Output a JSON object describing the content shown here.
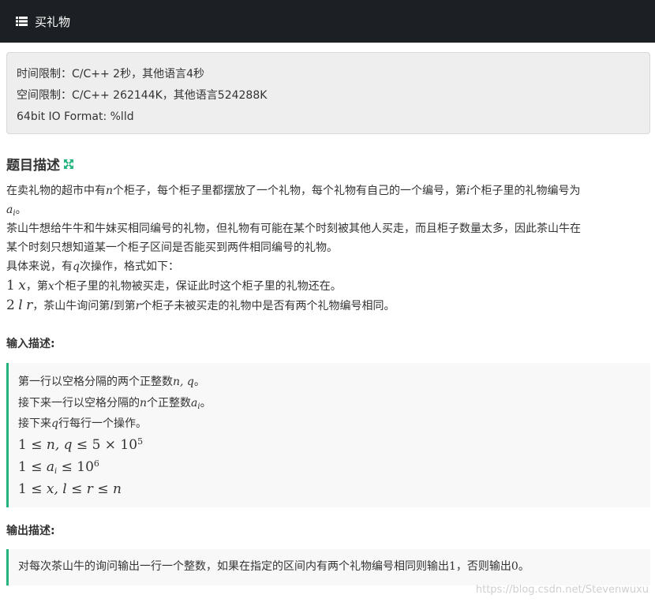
{
  "header": {
    "title": "买礼物",
    "icon": "list-icon"
  },
  "limits": {
    "time": "时间限制：C/C++ 2秒，其他语言4秒",
    "space": "空间限制：C/C++ 262144K，其他语言524288K",
    "format": "64bit IO Format: %lld"
  },
  "problem": {
    "title": "题目描述",
    "l1a": "在卖礼物的超市中有",
    "l1v1": "n",
    "l1b": "个柜子，每个柜子里都摆放了一个礼物，每个礼物有自己的一个编号，第",
    "l1v2": "i",
    "l1c": "个柜子里的礼物编号为",
    "l2v": "a",
    "l2s": "i",
    "l2p": "。",
    "l3": "茶山牛想给牛牛和牛妹买相同编号的礼物，但礼物有可能在某个时刻被其他人买走，而且柜子数量太多，因此茶山牛在",
    "l4": "某个时刻只想知道某一个柜子区间是否能买到两件相同编号的礼物。",
    "l5a": "具体来说，有",
    "l5v": "q",
    "l5b": "次操作，格式如下：",
    "op1n": "1",
    "op1v": "x",
    "op1a": "，第",
    "op1v2": "x",
    "op1b": "个柜子里的礼物被买走，保证此时这个柜子里的礼物还在。",
    "op2n": "2",
    "op2v": "l",
    "op2v2": "r",
    "op2a": "，茶山牛询问第",
    "op2v3": "l",
    "op2b": "到第",
    "op2v4": "r",
    "op2c": "个柜子未被买走的礼物中是否有两个礼物编号相同。"
  },
  "input": {
    "title": "输入描述:",
    "l1a": "第一行以空格分隔的两个正整数",
    "l1v": "n, q",
    "l1b": "。",
    "l2a": "接下来一行以空格分隔的",
    "l2v": "n",
    "l2b": "个正整数",
    "l2v2": "a",
    "l2s": "i",
    "l2c": "。",
    "l3a": "接下来",
    "l3v": "q",
    "l3b": "行每行一个操作。",
    "c1a": "1 ≤ ",
    "c1v": "n, q",
    "c1b": " ≤ 5 × 10",
    "c1e": "5",
    "c2a": "1 ≤ ",
    "c2v": "a",
    "c2s": "i",
    "c2b": " ≤ 10",
    "c2e": "6",
    "c3a": "1 ≤ ",
    "c3v": "x, l",
    "c3b": " ≤ ",
    "c3v2": "r",
    "c3c": " ≤ ",
    "c3v3": "n"
  },
  "output": {
    "title": "输出描述:",
    "l1a": "对每次茶山牛的询问输出一行一个整数，如果在指定的区间内有两个礼物编号相同则输出",
    "l1n1": "1",
    "l1b": "，否则输出",
    "l1n2": "0",
    "l1c": "。"
  },
  "watermark": "https://blog.csdn.net/Stevenwuxu",
  "colors": {
    "header_bg": "#1c2024",
    "accent": "#23b47e",
    "panel_bg": "#eeeeee"
  }
}
